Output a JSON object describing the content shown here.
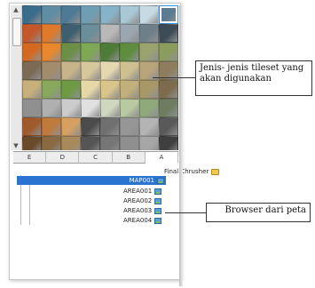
{
  "colors": {
    "selection": "#2a73d0",
    "panel_border": "#c9c9c9",
    "folder": "#f1c74d",
    "map_icon": "#5aa0d8"
  },
  "tileset": {
    "rows": [
      [
        "#3a6c8c",
        "#5f8da4",
        "#4e7a96",
        "#6d9eb4",
        "#87b3c9",
        "#a9c8d6",
        "#c7dbe4",
        "#5c7b92"
      ],
      [
        "#c4582a",
        "#e07a2a",
        "#3e5f6f",
        "#6a8e9a",
        "#b9b9b9",
        "#9aa6b0",
        "#6f7f8a",
        "#3c4b54"
      ],
      [
        "#d46a22",
        "#e8872c",
        "#6b8f47",
        "#7fa854",
        "#4f7b39",
        "#5e8d3e",
        "#9aa370",
        "#8c9c5d"
      ],
      [
        "#7b6a54",
        "#a28c6c",
        "#c8b48a",
        "#d7c79c",
        "#e4d8b0",
        "#cfc08f",
        "#b8a57a",
        "#8d7d5e"
      ],
      [
        "#c9b07a",
        "#88a85c",
        "#6e9a44",
        "#e7d8a8",
        "#d9c48a",
        "#c2b07a",
        "#a89868",
        "#7c6b4c"
      ],
      [
        "#909090",
        "#b0b0b0",
        "#cccccc",
        "#e0e0e0",
        "#d0d7c0",
        "#b9c9a0",
        "#8fa97a",
        "#6e7c60"
      ],
      [
        "#a05a2c",
        "#c07a3c",
        "#d6a060",
        "#4c4c4c",
        "#707070",
        "#969696",
        "#b4b4b4",
        "#595959"
      ],
      [
        "#6a4a2a",
        "#8a6a40",
        "#a88a5a",
        "#555555",
        "#767676",
        "#8f8f8f",
        "#a6a6a6",
        "#3f3f3f"
      ]
    ],
    "selected_tile": "0-7"
  },
  "tabs": [
    "A",
    "B",
    "C",
    "D",
    "E"
  ],
  "active_tab": "A",
  "tree": {
    "root": "Final Chrusher",
    "map": "MAP001",
    "areas": [
      "AREA001",
      "AREA002",
      "AREA003",
      "AREA004"
    ]
  },
  "callouts": {
    "tileset_note": "Jenis- jenis tileset yang akan digunakan",
    "browser_note": "Browser dari peta"
  }
}
